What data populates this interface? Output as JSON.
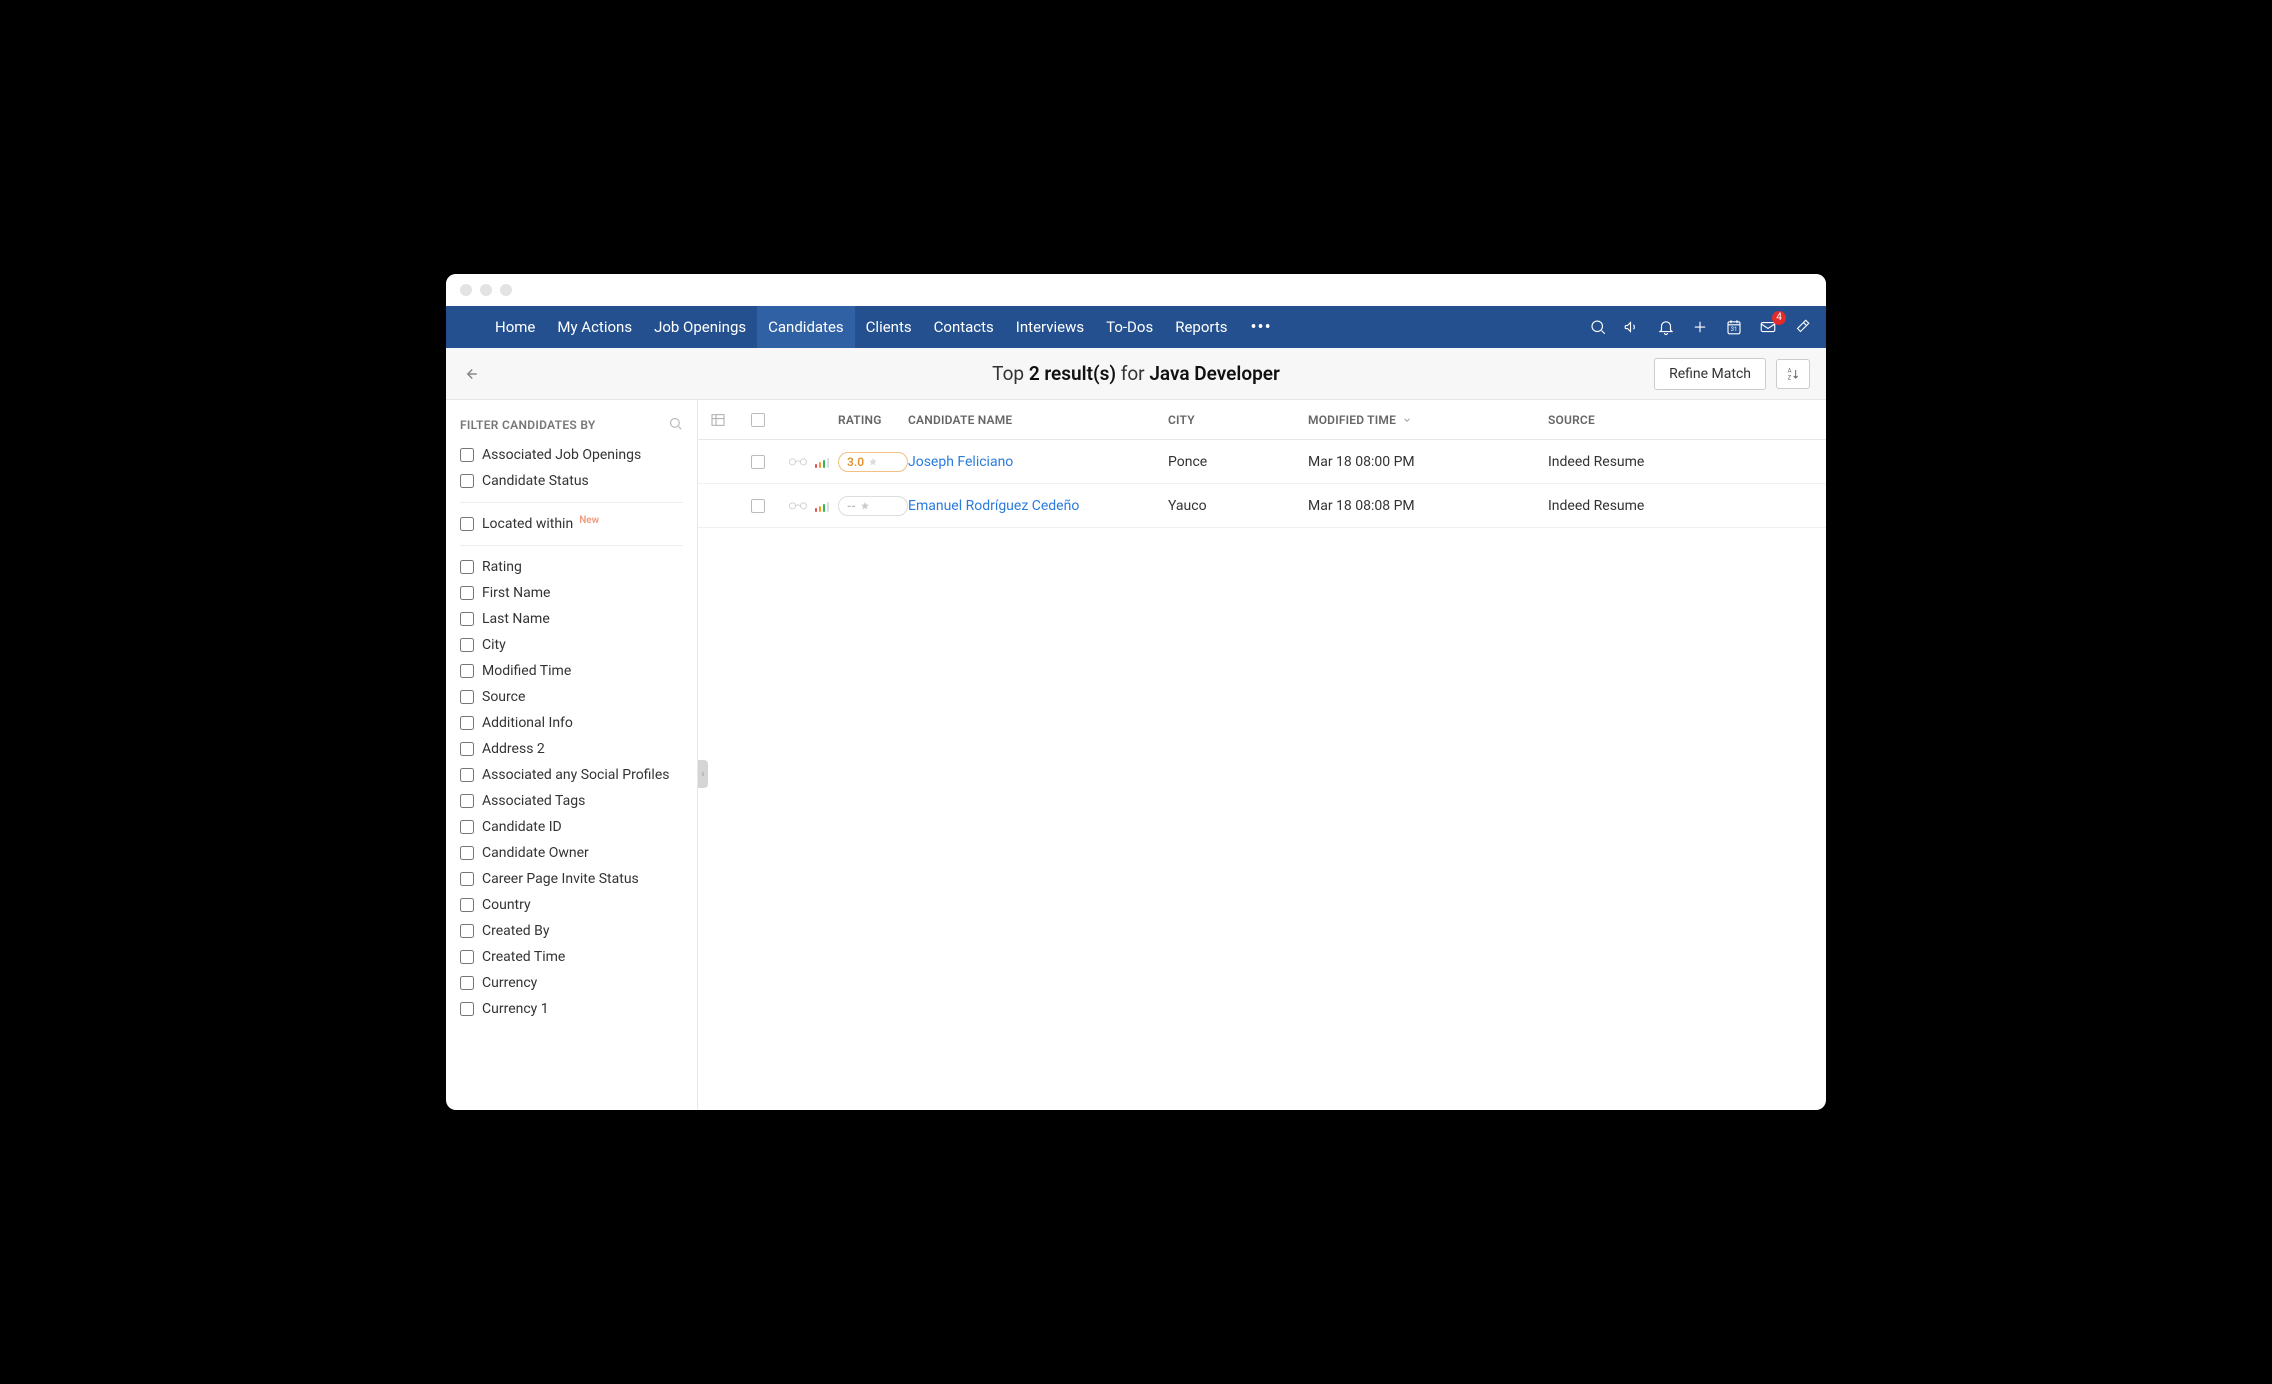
{
  "nav": {
    "items": [
      "Home",
      "My Actions",
      "Job Openings",
      "Candidates",
      "Clients",
      "Contacts",
      "Interviews",
      "To-Dos",
      "Reports"
    ],
    "activeIndex": 3,
    "mailBadge": "4"
  },
  "subheader": {
    "lead": "Top ",
    "count": "2 result(s)",
    "for": " for ",
    "term": "Java Developer",
    "refine": "Refine Match"
  },
  "sidebar": {
    "title": "FILTER CANDIDATES BY",
    "group1": [
      "Associated Job Openings",
      "Candidate Status"
    ],
    "locatedWithin": "Located within",
    "newTag": "New",
    "group2": [
      "Rating",
      "First Name",
      "Last Name",
      "City",
      "Modified Time",
      "Source",
      "Additional Info",
      "Address 2",
      "Associated any Social Profiles",
      "Associated Tags",
      "Candidate ID",
      "Candidate Owner",
      "Career Page Invite Status",
      "Country",
      "Created By",
      "Created Time",
      "Currency",
      "Currency 1"
    ]
  },
  "table": {
    "headers": {
      "rating": "RATING",
      "name": "CANDIDATE NAME",
      "city": "CITY",
      "modified": "MODIFIED TIME",
      "source": "SOURCE"
    },
    "rows": [
      {
        "rating": "3.0",
        "name": "Joseph Feliciano",
        "city": "Ponce",
        "modified": "Mar 18 08:00 PM",
        "source": "Indeed Resume"
      },
      {
        "rating": "--",
        "name": "Emanuel Rodríguez Cedeño",
        "city": "Yauco",
        "modified": "Mar 18 08:08 PM",
        "source": "Indeed Resume"
      }
    ]
  }
}
